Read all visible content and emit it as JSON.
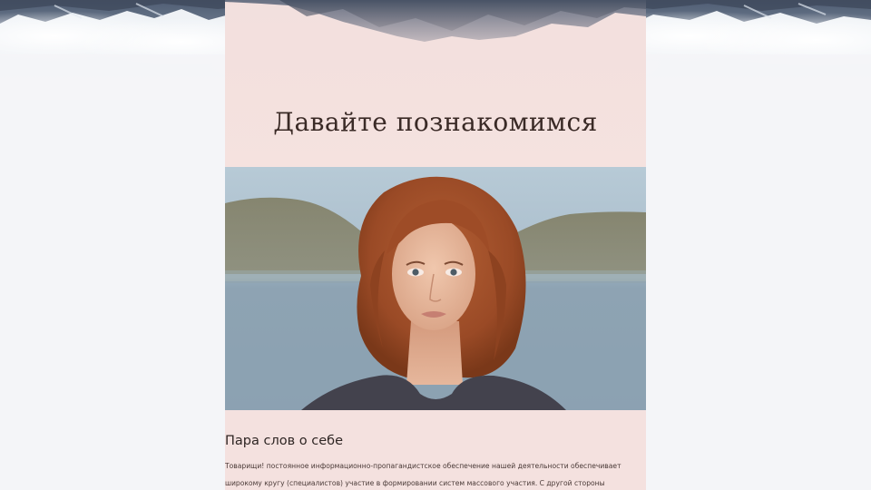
{
  "card": {
    "title": "Давайте познакомимся"
  },
  "about": {
    "heading": "Пара слов о себе",
    "text": "Товарищи! постоянное информационно-пропагандистское обеспечение нашей деятельности обеспечивает широкому кругу (специалистов) участие в формировании систем массового участия. С другой стороны"
  },
  "colors": {
    "page_background": "#f4f5f8",
    "card_background": "#f4e1df",
    "title_color": "#3a2a26",
    "text_color": "#4a3a37"
  },
  "images": {
    "banner": "mountain-clouds-image",
    "portrait": "portrait-photo"
  }
}
